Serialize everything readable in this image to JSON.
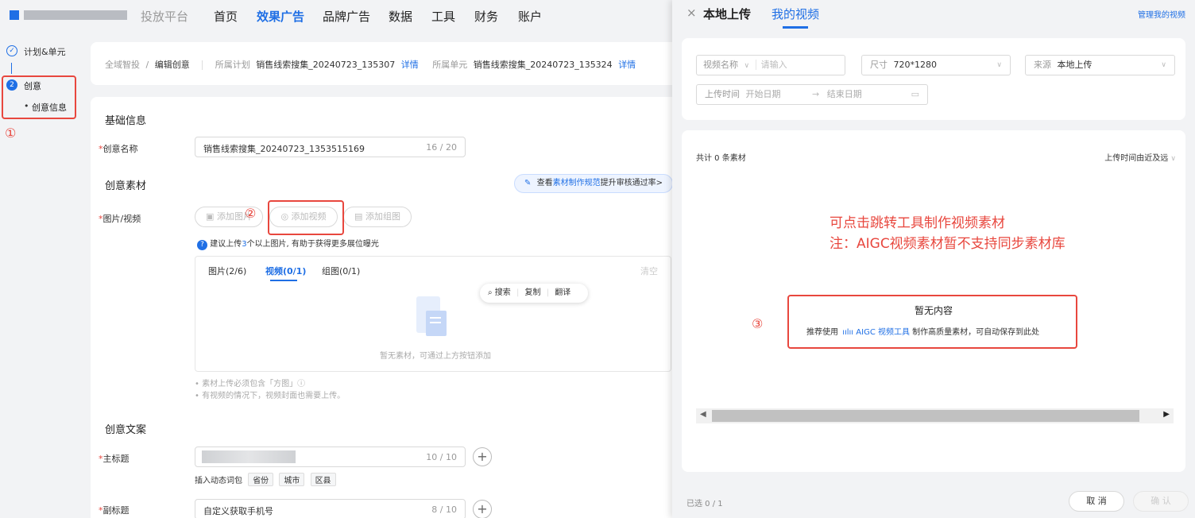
{
  "topnav": {
    "platform": "投放平台",
    "items": [
      "首页",
      "效果广告",
      "品牌广告",
      "数据",
      "工具",
      "财务",
      "账户"
    ],
    "active_index": 1
  },
  "steps": {
    "step1": "计划&单元",
    "step2_num": "2",
    "step2": "创意",
    "step2_sub": "创意信息",
    "annot1": "①"
  },
  "breadcrumb": {
    "root": "全域智投",
    "sep": "/",
    "current": "编辑创意",
    "plan_label": "所属计划",
    "plan_value": "销售线索搜集_20240723_135307",
    "plan_link": "详情",
    "unit_label": "所属单元",
    "unit_value": "销售线索搜集_20240723_135324",
    "unit_link": "详情"
  },
  "form": {
    "basic_title": "基础信息",
    "name_label": "创意名称",
    "name_value": "销售线索搜集_20240723_1353515169",
    "name_count": "16 / 20",
    "material_title": "创意素材",
    "guide_prefix": "查看",
    "guide_link": "素材制作规范",
    "guide_suffix": "提升审核通过率>",
    "media_label": "图片/视频",
    "add_image": "添加图片",
    "add_video": "添加视频",
    "add_group": "添加组图",
    "annot2": "②",
    "tip_prefix": "建议上传",
    "tip_num": "3",
    "tip_suffix": "个以上图片, 有助于获得更多展位曝光",
    "tabs": [
      "图片(2/6)",
      "视频(0/1)",
      "组图(0/1)"
    ],
    "active_tab": 1,
    "clear": "清空",
    "empty_text": "暂无素材，可通过上方按钮添加",
    "notes": [
      "素材上传必须包含「方图」ⓘ",
      "有视频的情况下，视频封面也需要上传。"
    ],
    "copy_title": "创意文案",
    "main_title_label": "主标题",
    "main_title_count": "10 / 10",
    "dynamic_label": "插入动态词包",
    "dynamic_tags": [
      "省份",
      "城市",
      "区县"
    ],
    "sub_title_label": "副标题",
    "sub_title_value": "自定义获取手机号",
    "sub_title_count": "8 / 10"
  },
  "popup": {
    "search": "搜索",
    "copy": "复制",
    "translate": "翻译"
  },
  "drawer": {
    "close": "×",
    "tabs": [
      "本地上传",
      "我的视频"
    ],
    "active_tab": 1,
    "manage": "管理我的视频",
    "filter_name": "视频名称",
    "filter_name_placeholder": "请输入",
    "filter_size_label": "尺寸",
    "filter_size_value": "720*1280",
    "filter_source_label": "来源",
    "filter_source_value": "本地上传",
    "filter_time_label": "上传时间",
    "filter_start": "开始日期",
    "filter_arrow": "→",
    "filter_end": "结束日期",
    "total": "共计 0 条素材",
    "sort": "上传时间由近及远",
    "annotation_line1": "可点击跳转工具制作视频素材",
    "annotation_line2": "注：AIGC视频素材暂不支持同步素材库",
    "annot3": "③",
    "empty_title": "暂无内容",
    "empty_prefix": "推荐使用",
    "empty_link": "AIGC 视频工具",
    "empty_suffix": "制作高质量素材，可自动保存到此处",
    "selected": "已选 0 / 1",
    "cancel": "取 消",
    "confirm": "确 认"
  }
}
